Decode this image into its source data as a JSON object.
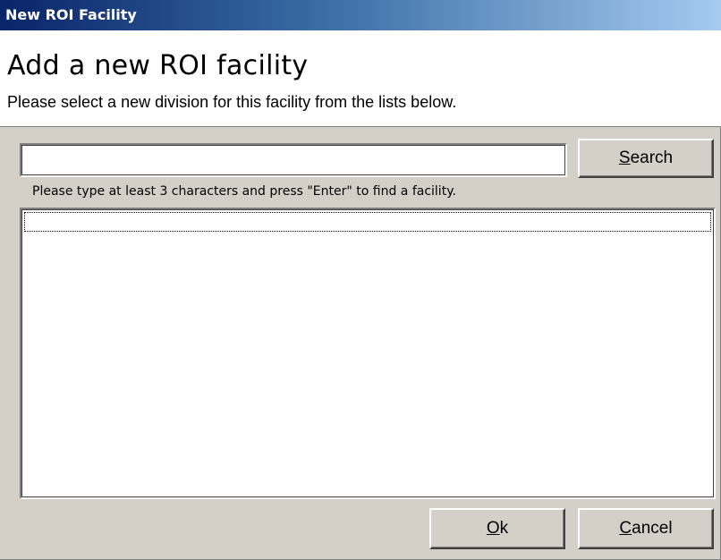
{
  "window": {
    "title": "New ROI Facility"
  },
  "header": {
    "title": "Add a new ROI facility",
    "subtitle": "Please select a new division for this facility from the lists below."
  },
  "search": {
    "value": "",
    "button": {
      "accel": "S",
      "rest": "earch"
    },
    "hint": "Please type at least 3 characters and press \"Enter\" to  find a facility."
  },
  "results": {
    "items": []
  },
  "footer": {
    "ok": {
      "accel": "O",
      "rest": "k"
    },
    "cancel": {
      "accel": "C",
      "rest": "ancel"
    }
  },
  "colors": {
    "face": "#d4d0c8",
    "title_start": "#0a246a",
    "title_end": "#a6caf0"
  }
}
